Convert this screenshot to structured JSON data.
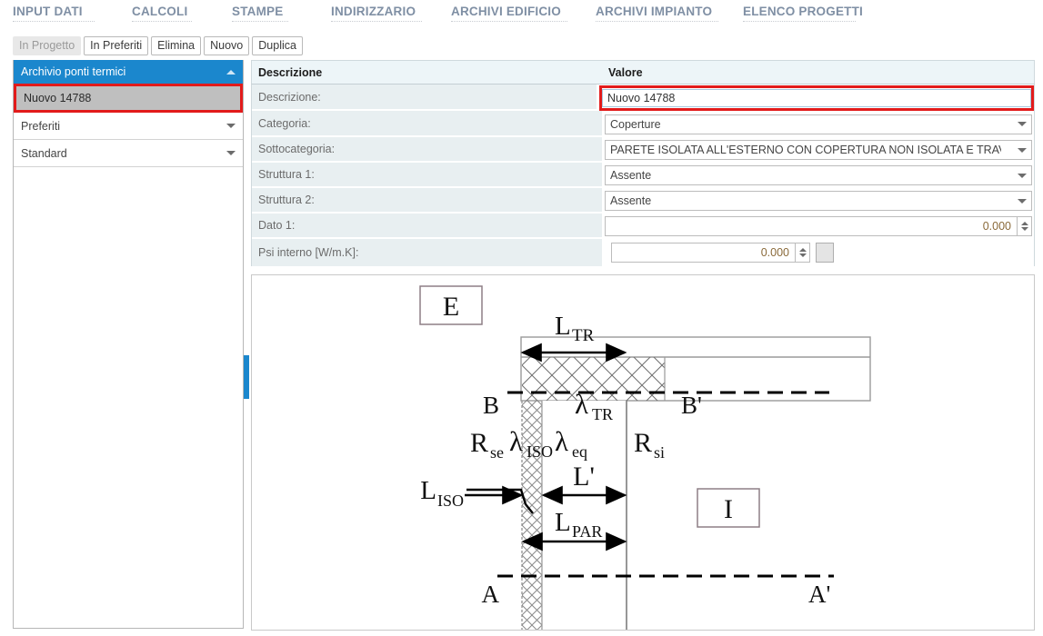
{
  "topnav": {
    "items": [
      {
        "label": "INPUT DATI"
      },
      {
        "label": "CALCOLI"
      },
      {
        "label": "STAMPE"
      },
      {
        "label": "INDIRIZZARIO"
      },
      {
        "label": "ARCHIVI EDIFICIO"
      },
      {
        "label": "ARCHIVI IMPIANTO"
      },
      {
        "label": "ELENCO PROGETTI"
      }
    ]
  },
  "toolbar": {
    "in_progetto": "In Progetto",
    "in_preferiti": "In Preferiti",
    "elimina": "Elimina",
    "nuovo": "Nuovo",
    "duplica": "Duplica"
  },
  "sidebar": {
    "header": "Archivio ponti termici",
    "selected_item": "Nuovo 14788",
    "groups": [
      {
        "label": "Preferiti"
      },
      {
        "label": "Standard"
      }
    ]
  },
  "grid": {
    "headers": {
      "descrizione": "Descrizione",
      "valore": "Valore"
    },
    "rows": [
      {
        "label": "Descrizione:",
        "value": "Nuovo 14788",
        "type": "text"
      },
      {
        "label": "Categoria:",
        "value": "Coperture",
        "type": "combo"
      },
      {
        "label": "Sottocategoria:",
        "value": "PARETE ISOLATA ALL'ESTERNO CON COPERTURA NON ISOLATA E TRAVE NON ISOLATA",
        "type": "combo"
      },
      {
        "label": "Struttura 1:",
        "value": "Assente",
        "type": "combo"
      },
      {
        "label": "Struttura 2:",
        "value": "Assente",
        "type": "combo"
      },
      {
        "label": "Dato 1:",
        "value": "0.000",
        "type": "spin"
      },
      {
        "label": "Psi interno [W/m.K]:",
        "value": "0.000",
        "type": "spin-small"
      }
    ]
  },
  "diagram": {
    "label_exterior": "E",
    "label_interior": "I",
    "label_B": "B",
    "label_Bp": "B'",
    "label_A": "A",
    "label_Ap": "A'",
    "dim_LTR": "L",
    "dim_LTR_sub": "TR",
    "dim_Lprime": "L'",
    "dim_LPAR": "L",
    "dim_LPAR_sub": "PAR",
    "dim_LISO": "L",
    "dim_LISO_sub": "ISO",
    "lambda_TR": "TR",
    "lambda_ISO": "ISO",
    "lambda_eq": "eq",
    "R_se": "R",
    "R_se_sub": "se",
    "R_si": "R",
    "R_si_sub": "si",
    "lambda_glyph": "λ"
  },
  "colors": {
    "accent": "#1b87cd",
    "highlight": "#e21b1b",
    "nav_text": "#7f8fa4",
    "row_bg": "#e8eff1",
    "header_bg": "#edf5f8"
  }
}
